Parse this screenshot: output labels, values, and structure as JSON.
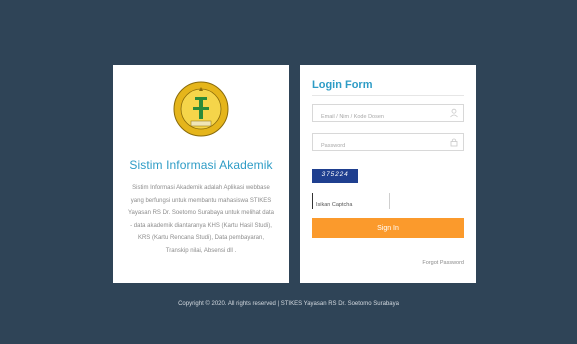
{
  "app": {
    "title": "Sistim Informasi Akademik",
    "description": "Sistim Informasi Akademik adalah Aplikasi webbase yang berfungsi untuk membantu mahasiswa STIKES Yayasan RS Dr. Soetomo Surabaya untuk melihat data - data akademik diantaranya KHS (Kartu Hasil Studi), KRS (Kartu Rencana Studi), Data pembayaran, Transkip nilai, Absensi dll ."
  },
  "login": {
    "title": "Login Form",
    "username_placeholder": "Email / Nim / Kode Dosen",
    "password_placeholder": "Password",
    "captcha_text": "375224",
    "captcha_placeholder": "Isikan Captcha",
    "signin_label": "Sign In",
    "forgot_label": "Forgot Password"
  },
  "footer": {
    "copyright": "Copyright © 2020. All rights reserved | STIKES Yayasan RS Dr. Soetomo Surabaya"
  },
  "colors": {
    "background": "#2f4457",
    "accent": "#2e9cc6",
    "button": "#fb9a2c"
  },
  "icons": {
    "username": "user-icon",
    "password": "lock-icon",
    "logo": "institution-seal-logo"
  }
}
